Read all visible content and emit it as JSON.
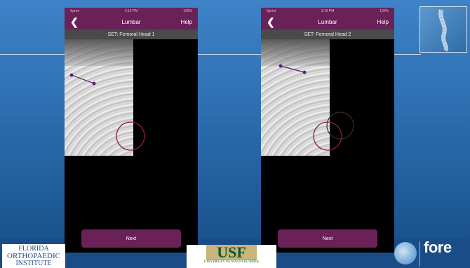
{
  "colors": {
    "app_purple": "#6a2157",
    "slide_blue": "#2d6fb1",
    "marker": "#5a1a7a",
    "circle": "#8a2040"
  },
  "phones": [
    {
      "status": {
        "carrier": "Sprint",
        "time": "3:15 PM",
        "battery": "100%"
      },
      "nav": {
        "back_icon": "chevron-left-icon",
        "title": "Lumbar",
        "help": "Help"
      },
      "set_label": "SET: Femoral Head 1",
      "next_label": "Next"
    },
    {
      "status": {
        "carrier": "Sprint",
        "time": "3:15 PM",
        "battery": "100%"
      },
      "nav": {
        "back_icon": "chevron-left-icon",
        "title": "Lumbar",
        "help": "Help"
      },
      "set_label": "SET: Femoral Head 2",
      "next_label": "Next"
    }
  ],
  "logos": {
    "foi": [
      "FLORIDA",
      "ORTHOPAEDIC",
      "INSTITUTE"
    ],
    "usf": {
      "mark": "USF",
      "name": "UNIVERSITY OF SOUTH FLORIDA"
    },
    "fore": "fore"
  }
}
